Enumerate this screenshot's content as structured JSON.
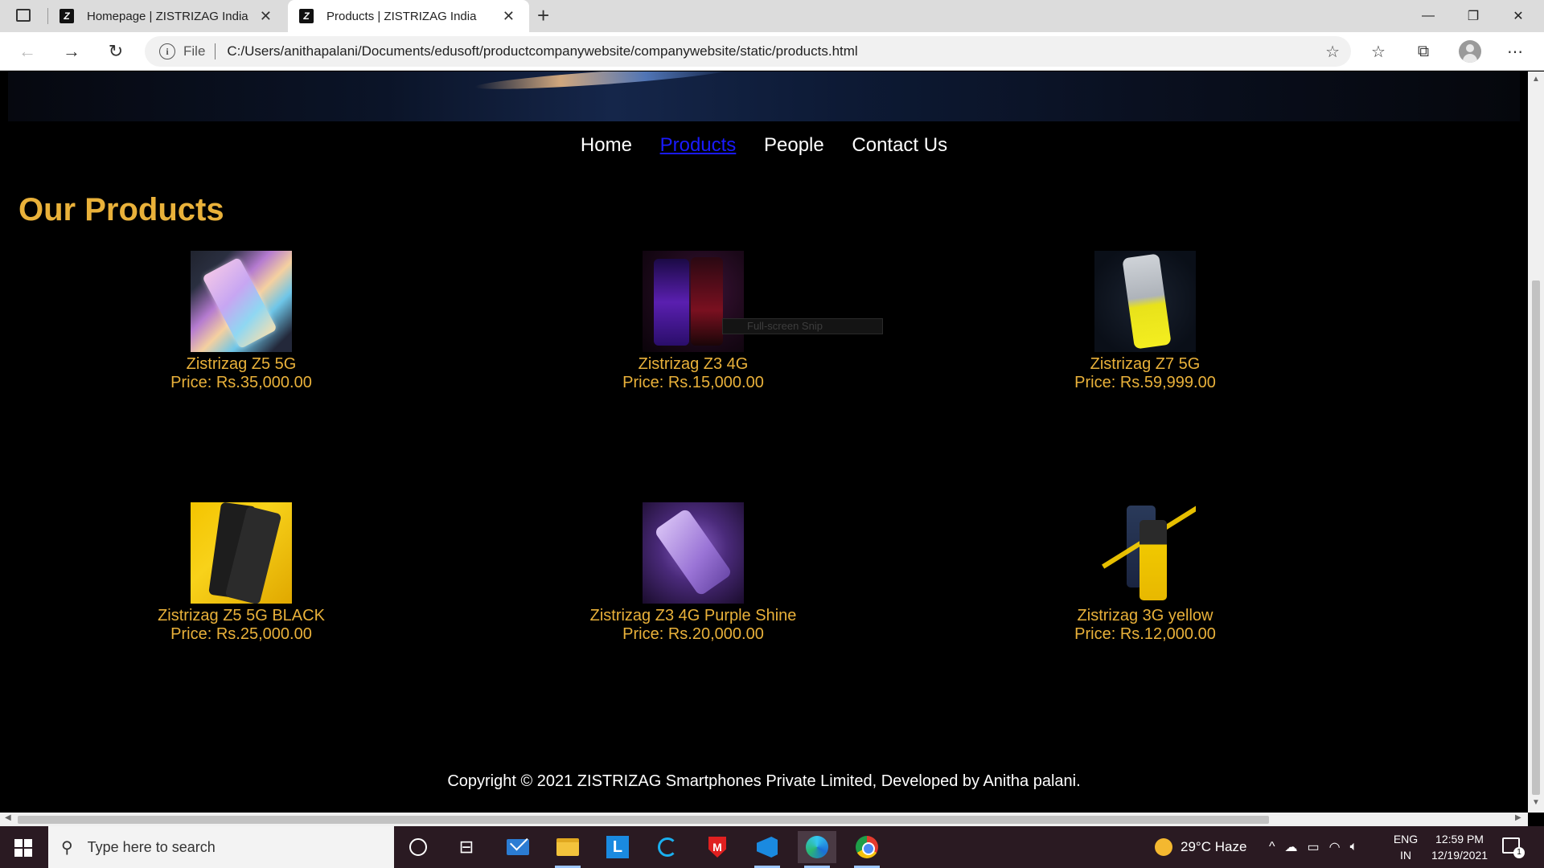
{
  "browser": {
    "tabs": [
      {
        "title": "Homepage | ZISTRIZAG India",
        "favicon": "Z"
      },
      {
        "title": "Products | ZISTRIZAG India",
        "favicon": "Z"
      }
    ],
    "url_scheme_label": "File",
    "url": "C:/Users/anithapalani/Documents/edusoft/productcompanywebsite/companywebsite/static/products.html"
  },
  "nav": {
    "items": [
      "Home",
      "Products",
      "People",
      "Contact Us"
    ],
    "active": "Products"
  },
  "page": {
    "heading": "Our Products",
    "overlay_text": "Full-screen Snip",
    "footer": "Copyright © 2021 ZISTRIZAG Smartphones Private Limited, Developed by Anitha palani."
  },
  "products": [
    {
      "name": "Zistrizag Z5 5G",
      "price": "Price: Rs.35,000.00"
    },
    {
      "name": "Zistrizag Z3 4G",
      "price": "Price: Rs.15,000.00"
    },
    {
      "name": "Zistrizag Z7 5G",
      "price": "Price: Rs.59,999.00"
    },
    {
      "name": "Zistrizag Z5 5G BLACK",
      "price": "Price: Rs.25,000.00"
    },
    {
      "name": "Zistrizag Z3 4G Purple Shine",
      "price": "Price: Rs.20,000.00"
    },
    {
      "name": "Zistrizag 3G yellow",
      "price": "Price: Rs.12,000.00"
    }
  ],
  "colors": {
    "accent": "#e9b13a",
    "active_link": "#1a1aff",
    "background": "#000000"
  },
  "taskbar": {
    "search_placeholder": "Type here to search",
    "weather": "29°C  Haze",
    "lang_top": "ENG",
    "lang_bottom": "IN",
    "time": "12:59 PM",
    "date": "12/19/2021",
    "notification_count": "1"
  }
}
